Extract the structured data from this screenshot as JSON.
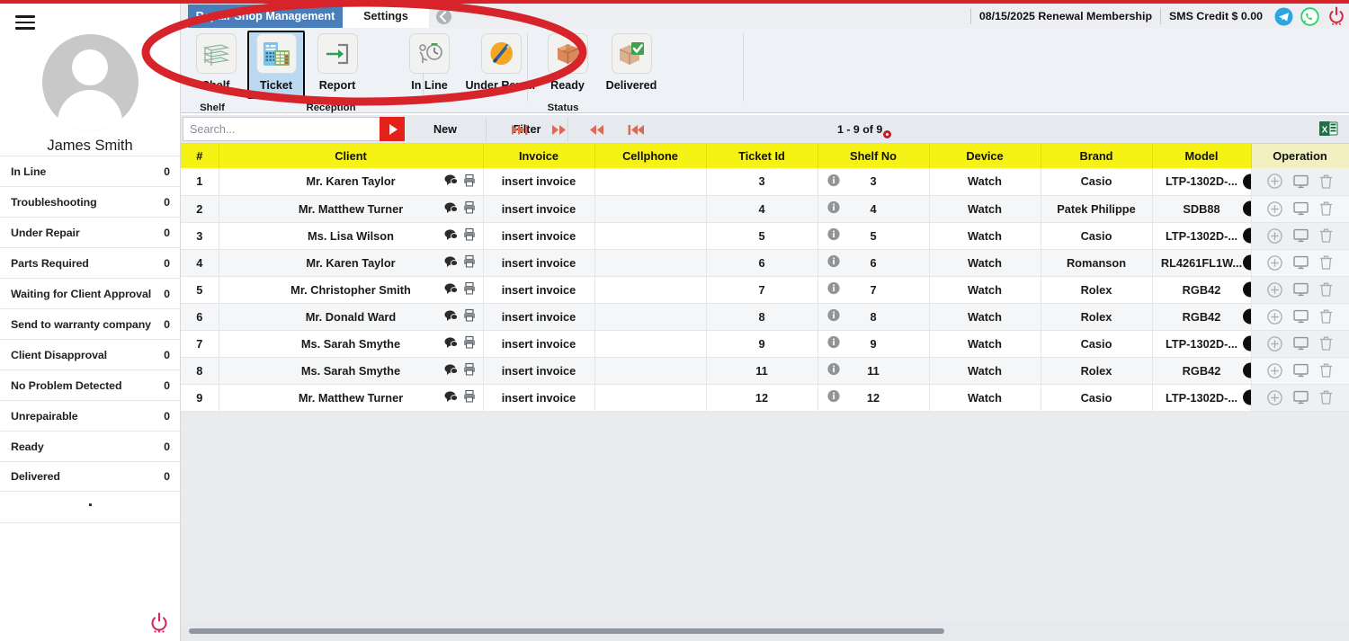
{
  "app": {
    "title": "Repair Shop Management",
    "user_name": "James Smith"
  },
  "topbar": {
    "tabs": [
      {
        "label": "Repair Shop Management",
        "active": true
      },
      {
        "label": "Settings",
        "active": false
      }
    ],
    "add_tab_icon": "add-tab-icon",
    "membership": "08/15/2025 Renewal Membership",
    "sms_credit": "SMS Credit $ 0.00",
    "icons": [
      {
        "name": "telegram-icon",
        "color": "#2ca5e0"
      },
      {
        "name": "whatsapp-icon",
        "color": "#25d366"
      },
      {
        "name": "power-icon",
        "color": "#d7263d"
      }
    ]
  },
  "ribbon": {
    "buttons": [
      {
        "label": "Shelf",
        "icon": "shelf-icon",
        "selected": false
      },
      {
        "label": "Ticket",
        "icon": "ticket-icon",
        "selected": true
      },
      {
        "label": "Report",
        "icon": "report-icon",
        "selected": false
      },
      {
        "label": "In Line",
        "icon": "in-line-icon",
        "selected": false
      },
      {
        "label": "Under Repair",
        "icon": "under-repair-icon",
        "selected": false
      },
      {
        "label": "Ready",
        "icon": "ready-icon",
        "selected": false
      },
      {
        "label": "Delivered",
        "icon": "delivered-icon",
        "selected": false
      }
    ],
    "groups": [
      {
        "label": "Shelf"
      },
      {
        "label": "Reception"
      },
      {
        "label": "Status"
      }
    ]
  },
  "sidebar": {
    "hamburger_icon": "hamburger-menu-icon",
    "avatar_icon": "user-avatar-icon",
    "power_icon": "power-off-icon",
    "items": [
      {
        "label": "In Line",
        "count": "0"
      },
      {
        "label": "Troubleshooting",
        "count": "0"
      },
      {
        "label": "Under Repair",
        "count": "0"
      },
      {
        "label": "Parts Required",
        "count": "0"
      },
      {
        "label": "Waiting for Client Approval",
        "count": "0"
      },
      {
        "label": "Send to warranty company",
        "count": "0"
      },
      {
        "label": "Client Disapproval",
        "count": "0"
      },
      {
        "label": "No Problem Detected",
        "count": "0"
      },
      {
        "label": "Unrepairable",
        "count": "0"
      },
      {
        "label": "Ready",
        "count": "0"
      },
      {
        "label": "Delivered",
        "count": "0"
      }
    ]
  },
  "actionbar": {
    "search_placeholder": "Search...",
    "search_value": "",
    "run_search_icon": "play-search-icon",
    "new_label": "New",
    "filter_label": "Filter",
    "pager": {
      "last_icon": "skip-to-last-icon",
      "next_icon": "next-page-icon",
      "prev_icon": "previous-page-icon",
      "first_icon": "skip-to-first-icon",
      "range": "1 - 9 of 9"
    },
    "export_icon": "excel-export-icon"
  },
  "table": {
    "columns": [
      "#",
      "Client",
      "Invoice",
      "Cellphone",
      "Ticket Id",
      "Shelf No",
      "Device",
      "Brand",
      "Model",
      "Operation"
    ],
    "row_icons": {
      "chat": "chat-bubble-icon",
      "print": "printer-icon",
      "info": "info-icon",
      "add": "add-circle-icon",
      "monitor": "monitor-icon",
      "delete": "trash-icon",
      "model_badge": "model-status-badge"
    },
    "rows": [
      {
        "num": "1",
        "client": "Mr. Karen Taylor",
        "invoice": "insert invoice",
        "cellphone": "",
        "ticket_id": "3",
        "shelf_no": "3",
        "device": "Watch",
        "brand": "Casio",
        "model": "LTP-1302D-..."
      },
      {
        "num": "2",
        "client": "Mr. Matthew Turner",
        "invoice": "insert invoice",
        "cellphone": "",
        "ticket_id": "4",
        "shelf_no": "4",
        "device": "Watch",
        "brand": "Patek Philippe",
        "model": "SDB88"
      },
      {
        "num": "3",
        "client": "Ms. Lisa Wilson",
        "invoice": "insert invoice",
        "cellphone": "",
        "ticket_id": "5",
        "shelf_no": "5",
        "device": "Watch",
        "brand": "Casio",
        "model": "LTP-1302D-..."
      },
      {
        "num": "4",
        "client": "Mr. Karen Taylor",
        "invoice": "insert invoice",
        "cellphone": "",
        "ticket_id": "6",
        "shelf_no": "6",
        "device": "Watch",
        "brand": "Romanson",
        "model": "RL4261FL1W..."
      },
      {
        "num": "5",
        "client": "Mr. Christopher Smith",
        "invoice": "insert invoice",
        "cellphone": "",
        "ticket_id": "7",
        "shelf_no": "7",
        "device": "Watch",
        "brand": "Rolex",
        "model": "RGB42"
      },
      {
        "num": "6",
        "client": "Mr. Donald Ward",
        "invoice": "insert invoice",
        "cellphone": "",
        "ticket_id": "8",
        "shelf_no": "8",
        "device": "Watch",
        "brand": "Rolex",
        "model": "RGB42"
      },
      {
        "num": "7",
        "client": "Ms. Sarah Smythe",
        "invoice": "insert invoice",
        "cellphone": "",
        "ticket_id": "9",
        "shelf_no": "9",
        "device": "Watch",
        "brand": "Casio",
        "model": "LTP-1302D-..."
      },
      {
        "num": "8",
        "client": "Ms. Sarah Smythe",
        "invoice": "insert invoice",
        "cellphone": "",
        "ticket_id": "11",
        "shelf_no": "11",
        "device": "Watch",
        "brand": "Rolex",
        "model": "RGB42"
      },
      {
        "num": "9",
        "client": "Mr. Matthew Turner",
        "invoice": "insert invoice",
        "cellphone": "",
        "ticket_id": "12",
        "shelf_no": "12",
        "device": "Watch",
        "brand": "Casio",
        "model": "LTP-1302D-..."
      }
    ]
  },
  "annotation": {
    "shape": "red-ellipse-highlight",
    "color": "#d7232a"
  },
  "colors": {
    "tab_active_bg": "#4a7ebb",
    "header_yellow": "#f7f216",
    "accent_red": "#e32119",
    "ribbon_selected": "#bcd9f2"
  }
}
